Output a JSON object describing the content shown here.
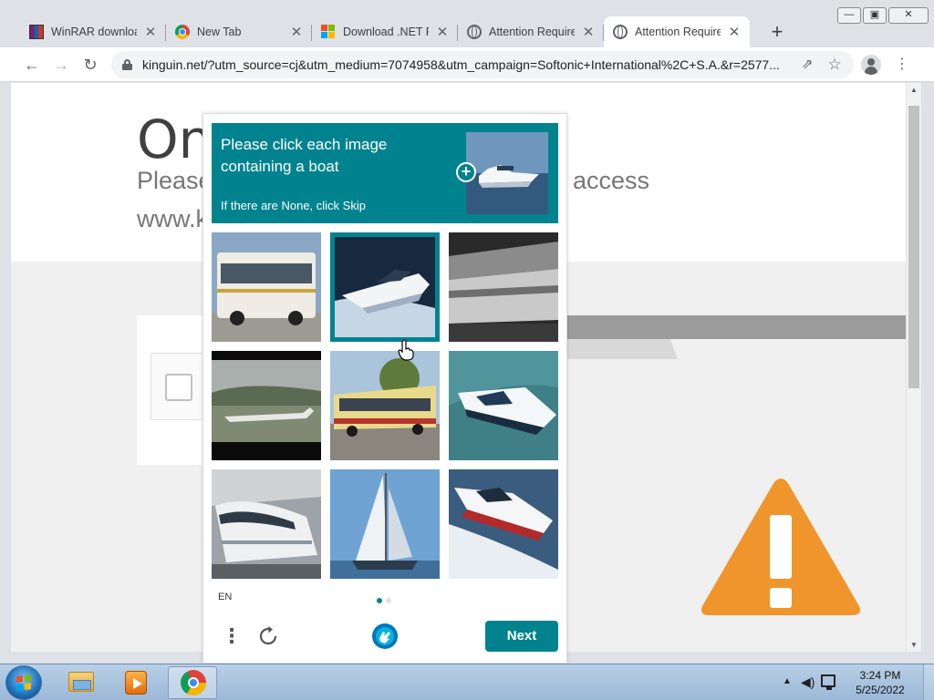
{
  "window": {
    "tabs": [
      {
        "title": "WinRAR download",
        "favicon": "winrar-icon"
      },
      {
        "title": "New Tab",
        "favicon": "chrome-icon"
      },
      {
        "title": "Download .NET Fr",
        "favicon": "microsoft-icon"
      },
      {
        "title": "Attention Required",
        "favicon": "globe-icon"
      },
      {
        "title": "Attention Required",
        "favicon": "globe-icon",
        "active": true
      }
    ],
    "url": "kinguin.net/?utm_source=cj&utm_medium=7074958&utm_campaign=Softonic+International%2C+S.A.&r=2577...",
    "controls": {
      "minimize": "▭",
      "restore": "▭",
      "close": "✕"
    }
  },
  "page": {
    "title": "On",
    "line1": "Please",
    "line2": "access",
    "line3": "www.k",
    "warning_color": "#f0952b"
  },
  "captcha": {
    "prompt": "Please click each image containing a boat",
    "sub": "If there are None, click Skip",
    "accent": "#00838f",
    "cells": [
      {
        "subject": "bus",
        "selected": false
      },
      {
        "subject": "boat",
        "selected": true
      },
      {
        "subject": "train",
        "selected": false
      },
      {
        "subject": "airplane",
        "selected": false
      },
      {
        "subject": "bus",
        "selected": false
      },
      {
        "subject": "boat",
        "selected": false
      },
      {
        "subject": "train",
        "selected": false
      },
      {
        "subject": "sailboat",
        "selected": false
      },
      {
        "subject": "boat",
        "selected": false
      }
    ],
    "language": "EN",
    "next_label": "Next"
  },
  "taskbar": {
    "time": "3:24 PM",
    "date": "5/25/2022"
  }
}
